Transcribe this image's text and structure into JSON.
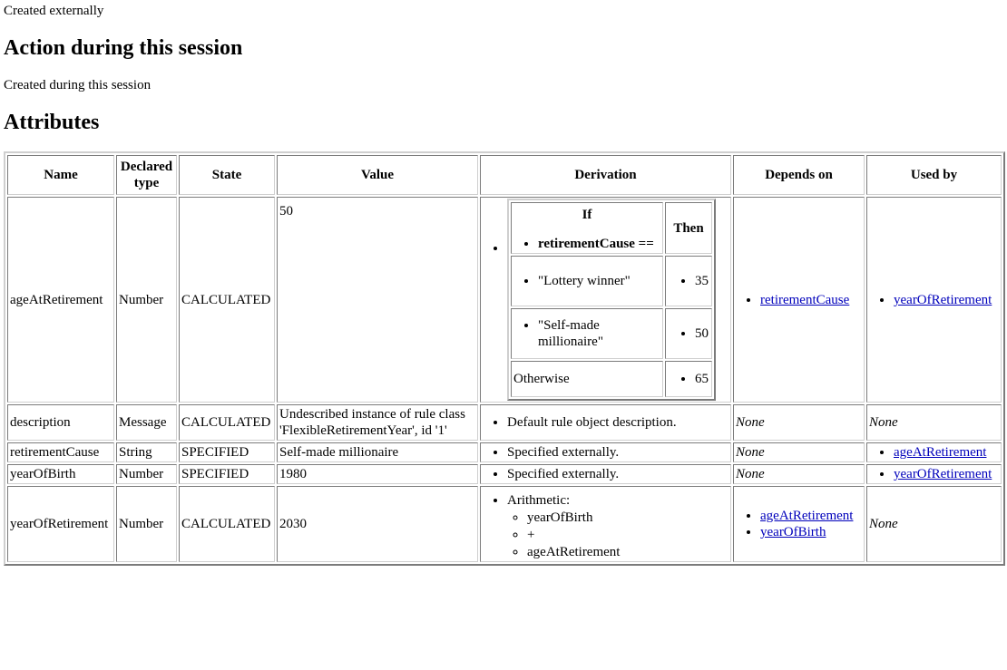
{
  "page": {
    "intro_text": "Created externally",
    "section_action_title": "Action during this session",
    "action_text": "Created during this session",
    "section_attributes_title": "Attributes"
  },
  "colors": {
    "link": "#0000bb",
    "text": "#000000",
    "background": "#ffffff",
    "table_border": "#cfcfcf"
  },
  "table": {
    "headers": {
      "name": "Name",
      "declared_type": "Declared type",
      "state": "State",
      "value": "Value",
      "derivation": "Derivation",
      "depends_on": "Depends on",
      "used_by": "Used by"
    },
    "rows": [
      {
        "name": "ageAtRetirement",
        "declared_type": "Number",
        "state": "CALCULATED",
        "value": "50",
        "derivation_kind": "decision-table",
        "decision_table": {
          "if_header": "If",
          "then_header": "Then",
          "condition": "retirementCause ==",
          "cases": [
            {
              "when": "\"Lottery winner\"",
              "then": "35"
            },
            {
              "when": "\"Self-made millionaire\"",
              "then": "50"
            }
          ],
          "otherwise_label": "Otherwise",
          "otherwise_then": "65"
        },
        "depends_on": [
          {
            "label": "retirementCause",
            "is_link": true
          }
        ],
        "used_by": [
          {
            "label": "yearOfRetirement",
            "is_link": true
          }
        ]
      },
      {
        "name": "description",
        "declared_type": "Message",
        "state": "CALCULATED",
        "value": "Undescribed instance of rule class 'FlexibleRetirementYear', id '1'",
        "derivation_kind": "list",
        "derivation_items": [
          "Default rule object description."
        ],
        "depends_on_none": "None",
        "used_by_none": "None"
      },
      {
        "name": "retirementCause",
        "declared_type": "String",
        "state": "SPECIFIED",
        "value": "Self-made millionaire",
        "derivation_kind": "list",
        "derivation_items": [
          "Specified externally."
        ],
        "depends_on_none": "None",
        "used_by": [
          {
            "label": "ageAtRetirement",
            "is_link": true
          }
        ]
      },
      {
        "name": "yearOfBirth",
        "declared_type": "Number",
        "state": "SPECIFIED",
        "value": "1980",
        "derivation_kind": "list",
        "derivation_items": [
          "Specified externally."
        ],
        "depends_on_none": "None",
        "used_by": [
          {
            "label": "yearOfRetirement",
            "is_link": true
          }
        ]
      },
      {
        "name": "yearOfRetirement",
        "declared_type": "Number",
        "state": "CALCULATED",
        "value": "2030",
        "derivation_kind": "arithmetic",
        "arithmetic_label": "Arithmetic:",
        "arithmetic_terms": [
          "yearOfBirth",
          "+",
          "ageAtRetirement"
        ],
        "depends_on": [
          {
            "label": "ageAtRetirement",
            "is_link": true
          },
          {
            "label": "yearOfBirth",
            "is_link": true
          }
        ],
        "used_by_none": "None"
      }
    ]
  }
}
